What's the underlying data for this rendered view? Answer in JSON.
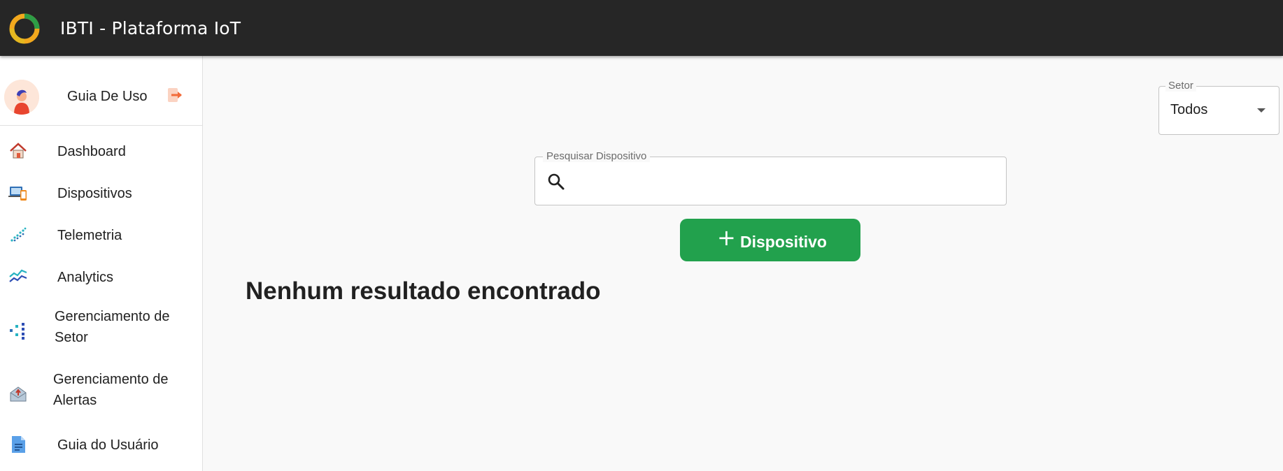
{
  "header": {
    "title": "IBTI - Plataforma IoT",
    "logo_icon": "ibti-ring-logo"
  },
  "profile": {
    "name": "Guia De Uso",
    "avatar_icon": "user-avatar-icon",
    "logout_icon": "logout-arrow-icon"
  },
  "sidebar": {
    "items": [
      {
        "label": "Dashboard",
        "icon": "home-icon"
      },
      {
        "label": "Dispositivos",
        "icon": "devices-icon"
      },
      {
        "label": "Telemetria",
        "icon": "telemetry-icon"
      },
      {
        "label": "Analytics",
        "icon": "analytics-icon"
      },
      {
        "label_line1": "Gerenciamento de",
        "label_line2": "Setor",
        "icon": "sector-management-icon"
      },
      {
        "label_line1": "Gerenciamento de",
        "label_line2": "Alertas",
        "icon": "alerts-management-icon"
      },
      {
        "label": "Guia do Usuário",
        "icon": "user-guide-icon"
      }
    ]
  },
  "filters": {
    "setor_label": "Setor",
    "setor_value": "Todos"
  },
  "search": {
    "label": "Pesquisar Dispositivo",
    "value": "",
    "placeholder": ""
  },
  "add_button": {
    "plus": "+",
    "label": "Dispositivo"
  },
  "results": {
    "empty_message": "Nenhum resultado encontrado"
  },
  "colors": {
    "topbar": "#262626",
    "accent_green": "#22a14d",
    "logout_orange": "#f26b3a"
  }
}
